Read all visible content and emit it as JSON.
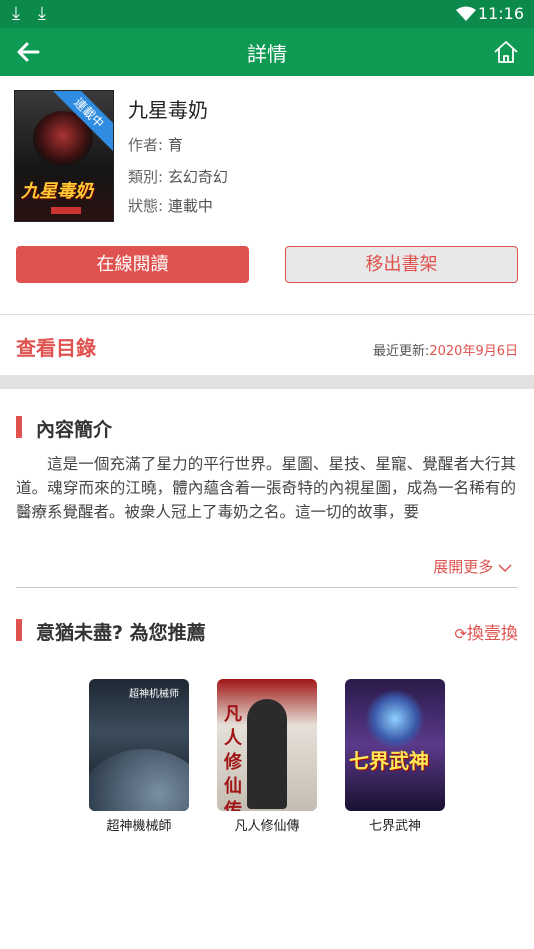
{
  "status_bar": {
    "time": "11:16",
    "download_icons": [
      "download-icon",
      "download-icon"
    ]
  },
  "app_bar": {
    "title": "詳情",
    "back_icon": "arrow-left-icon",
    "home_icon": "home-icon"
  },
  "book": {
    "cover": {
      "ribbon": "連載中",
      "title": "九星毒奶"
    },
    "name": "九星毒奶",
    "author_label": "作者:",
    "author": "育",
    "category_label": "類別:",
    "category": "玄幻奇幻",
    "status_label": "狀態:",
    "status": "連載中"
  },
  "actions": {
    "read_online": "在線閱讀",
    "remove_shelf": "移出書架"
  },
  "toc": {
    "label": "查看目錄",
    "updated_label": "最近更新:",
    "updated_date": "2020年9月6日"
  },
  "intro": {
    "heading": "內容簡介",
    "text": "這是一個充滿了星力的平行世界。星圖、星技、星寵、覺醒者大行其道。魂穿而來的江曉，體內蘊含着一張奇特的內視星圖，成為一名稀有的醫療系覺醒者。被衆人冠上了毒奶之名。這一切的故事，要",
    "expand": "展開更多"
  },
  "recommend": {
    "heading": "意猶未盡? 為您推薦",
    "refresh_label": "換壹換",
    "books": [
      {
        "title": "超神機械師",
        "cover_text": "超神机械师"
      },
      {
        "title": "凡人修仙傳",
        "cover_text": "凡人修仙传"
      },
      {
        "title": "七界武神",
        "cover_text": "七界武神"
      }
    ]
  },
  "colors": {
    "primary_green": "#0e9a53",
    "accent_red": "#e0524f"
  }
}
